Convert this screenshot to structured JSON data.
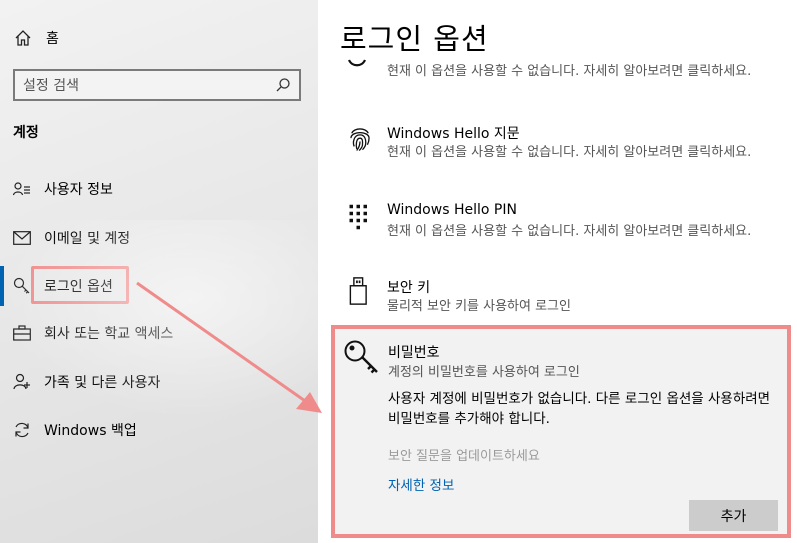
{
  "sidebar": {
    "home_label": "홈",
    "search_placeholder": "설정 검색",
    "section_title": "계정",
    "items": [
      {
        "label": "사용자 정보",
        "icon": "user-info-icon"
      },
      {
        "label": "이메일 및 계정",
        "icon": "mail-icon"
      },
      {
        "label": "로그인 옵션",
        "icon": "key-icon"
      },
      {
        "label": "회사 또는 학교 액세스",
        "icon": "briefcase-icon"
      },
      {
        "label": "가족 및 다른 사용자",
        "icon": "add-user-icon"
      },
      {
        "label": "Windows 백업",
        "icon": "sync-icon"
      }
    ],
    "active_index": 2
  },
  "main": {
    "title": "로그인 옵션",
    "options": [
      {
        "title": "",
        "desc": "현재 이 옵션을 사용할 수 없습니다. 자세히 알아보려면 클릭하세요.",
        "icon": "face-icon"
      },
      {
        "title": "Windows Hello 지문",
        "desc": "현재 이 옵션을 사용할 수 없습니다. 자세히 알아보려면 클릭하세요.",
        "icon": "fingerprint-icon"
      },
      {
        "title": "Windows Hello PIN",
        "desc": "현재 이 옵션을 사용할 수 없습니다. 자세히 알아보려면 클릭하세요.",
        "icon": "pin-keypad-icon"
      },
      {
        "title": "보안 키",
        "desc": "물리적 보안 키를 사용하여 로그인",
        "icon": "usb-key-icon"
      }
    ],
    "password": {
      "title": "비밀번호",
      "subtitle": "계정의 비밀번호를 사용하여 로그인",
      "message": "사용자 계정에 비밀번호가 없습니다. 다른 로그인 옵션을 사용하려면 비밀번호를 추가해야 합니다.",
      "update_link": "보안 질문을 업데이트하세요",
      "more_info": "자세한 정보",
      "add_button": "추가",
      "icon": "password-key-icon"
    }
  },
  "colors": {
    "accent": "#0063b1",
    "annotation": "#f08b8b"
  }
}
